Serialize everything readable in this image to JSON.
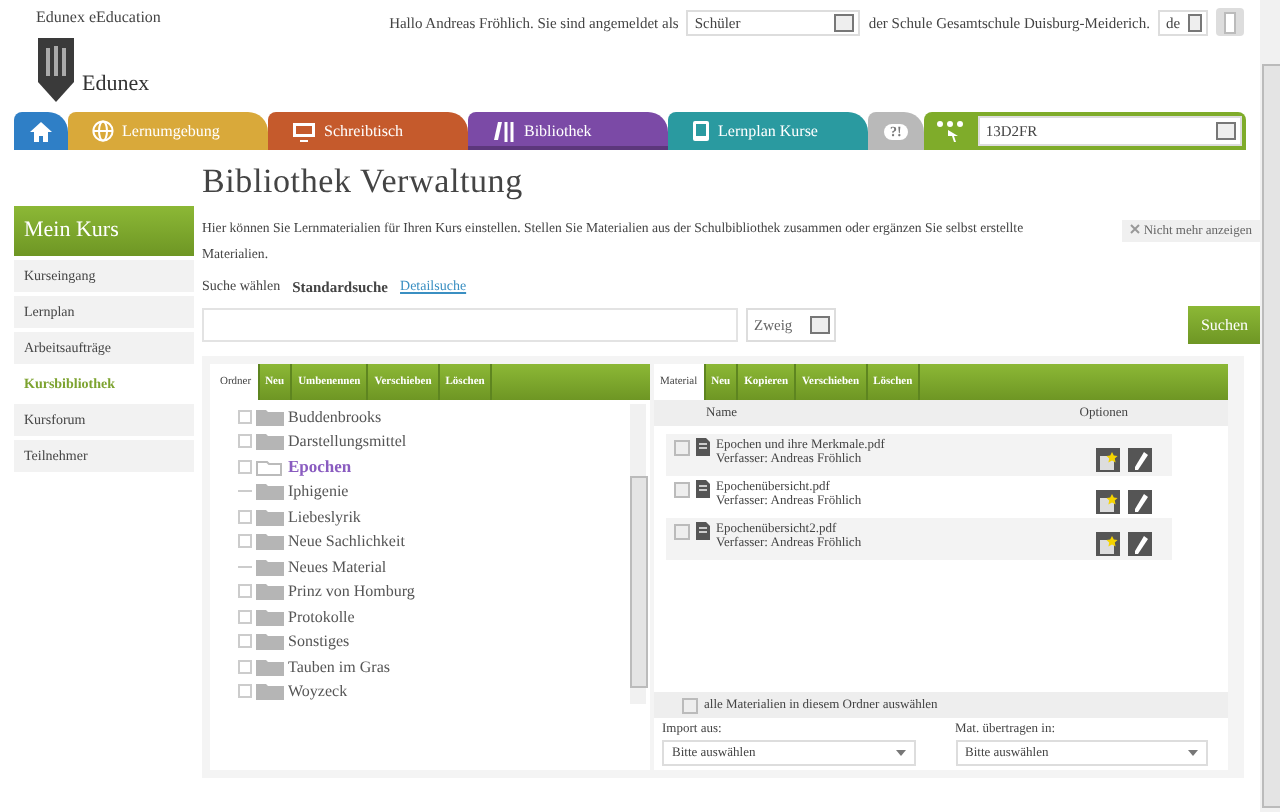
{
  "header": {
    "brand": "Edunex eEducation",
    "logo_text": "Edunex",
    "greeting": "Hallo Andreas Fröhlich. Sie sind angemeldet als",
    "role_select": "Schüler",
    "school_text": "der Schule Gesamtschule Duisburg-Meiderich.",
    "language_select": "de"
  },
  "nav": {
    "tabs": [
      {
        "kind": "home",
        "selected": false
      },
      {
        "kind": "globe",
        "label": "Lernumgebung",
        "selected": false
      },
      {
        "kind": "monitor",
        "label": "Schreibtisch",
        "selected": false
      },
      {
        "kind": "books",
        "label": "Bibliothek",
        "selected": true
      },
      {
        "kind": "tablet",
        "label": "Lernplan Kurse",
        "selected": false
      },
      {
        "kind": "help",
        "label": "?!",
        "selected": false
      }
    ],
    "course_select": "13D2FR"
  },
  "sidebar": {
    "title": "Mein Kurs",
    "items": [
      {
        "label": "Kurseingang",
        "selected": false
      },
      {
        "label": "Lernplan",
        "selected": false
      },
      {
        "label": "Arbeitsaufträge",
        "selected": false
      },
      {
        "label": "Kursbibliothek",
        "selected": true
      },
      {
        "label": "Kursforum",
        "selected": false
      },
      {
        "label": "Teilnehmer",
        "selected": false
      }
    ]
  },
  "page_title": "Bibliothek Verwaltung",
  "description": "Hier können Sie Lernmaterialien für Ihren Kurs einstellen. Stellen Sie Materialien aus der Schulbibliothek zusammen oder ergänzen Sie selbst erstellte Materialien.",
  "dismiss_button": "Nicht mehr anzeigen",
  "search": {
    "label": "Suche wählen",
    "modes": [
      {
        "label": "Standardsuche",
        "selected": true
      },
      {
        "label": "Detailsuche",
        "selected": false
      }
    ],
    "scope_select": "Zweig",
    "button": "Suchen"
  },
  "folder_panel": {
    "tabs": [
      {
        "label": "Ordner",
        "selected": true
      },
      {
        "label": "Neu",
        "selected": false
      },
      {
        "label": "Umbenennen",
        "selected": false
      },
      {
        "label": "Verschieben",
        "selected": false
      },
      {
        "label": "Löschen",
        "selected": false
      }
    ],
    "folders": [
      {
        "label": "Buddenbrooks",
        "expandable": true,
        "selected": false
      },
      {
        "label": "Darstellungsmittel",
        "expandable": true,
        "selected": false
      },
      {
        "label": "Epochen",
        "expandable": true,
        "selected": true
      },
      {
        "label": "Iphigenie",
        "expandable": false,
        "selected": false
      },
      {
        "label": "Liebeslyrik",
        "expandable": true,
        "selected": false
      },
      {
        "label": "Neue Sachlichkeit",
        "expandable": true,
        "selected": false
      },
      {
        "label": "Neues Material",
        "expandable": false,
        "selected": false
      },
      {
        "label": "Prinz von Homburg",
        "expandable": true,
        "selected": false
      },
      {
        "label": "Protokolle",
        "expandable": true,
        "selected": false
      },
      {
        "label": "Sonstiges",
        "expandable": true,
        "selected": false
      },
      {
        "label": "Tauben im Gras",
        "expandable": true,
        "selected": false
      },
      {
        "label": "Woyzeck",
        "expandable": true,
        "selected": false
      }
    ]
  },
  "material_panel": {
    "tabs": [
      {
        "label": "Material",
        "selected": true
      },
      {
        "label": "Neu",
        "selected": false
      },
      {
        "label": "Kopieren",
        "selected": false
      },
      {
        "label": "Verschieben",
        "selected": false
      },
      {
        "label": "Löschen",
        "selected": false
      }
    ],
    "columns": [
      "Name",
      "Optionen"
    ],
    "files": [
      {
        "name": "Epochen und ihre Merkmale.pdf",
        "author": "Verfasser: Andreas Fröhlich",
        "checked": false
      },
      {
        "name": "Epochenübersicht.pdf",
        "author": "Verfasser: Andreas Fröhlich",
        "checked": false
      },
      {
        "name": "Epochenübersicht2.pdf",
        "author": "Verfasser: Andreas Fröhlich",
        "checked": false
      }
    ],
    "select_all": {
      "label": "alle Materialien in diesem Ordner auswählen",
      "checked": false
    },
    "import_label": "Import aus:",
    "import_select": "Bitte auswählen",
    "transfer_label": "Mat. übertragen in:",
    "transfer_select": "Bitte auswählen"
  }
}
